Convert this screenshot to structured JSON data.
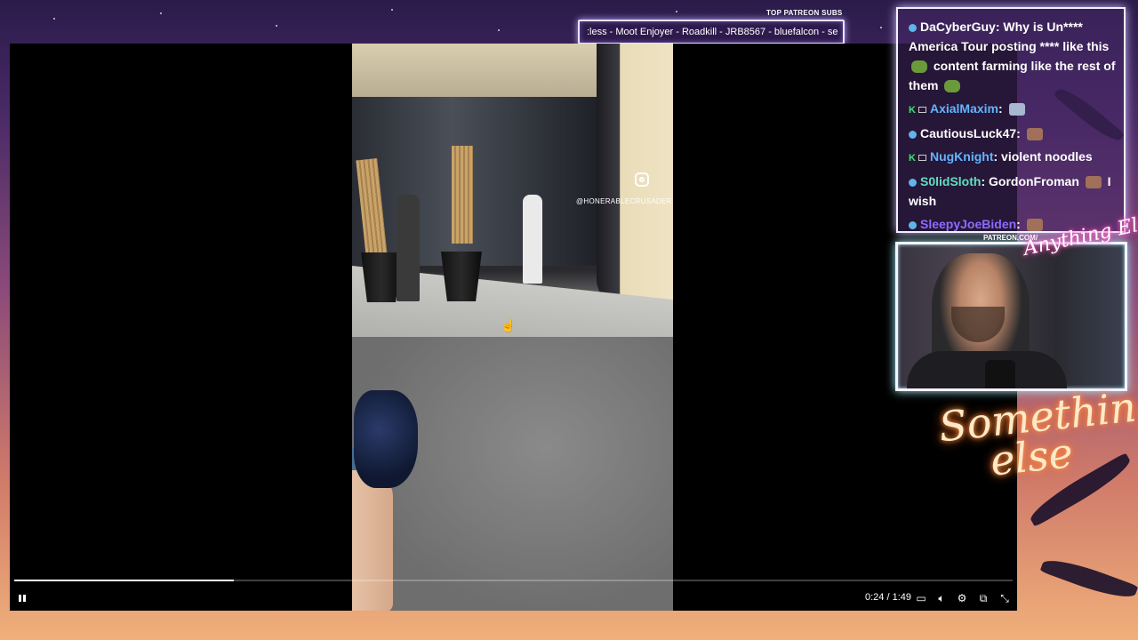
{
  "ticker": {
    "title": "TOP PATREON SUBS",
    "text": ":less - Moot Enjoyer - Roadkill - JRB8567 - bluefalcon - se"
  },
  "video": {
    "watermark_handle": "@HONERABLECRUSADER",
    "time": "0:24 / 1:49",
    "progress_fraction": 0.22
  },
  "chat": {
    "messages": [
      {
        "user": "DaCyberGuy",
        "user_color": "#ffffff",
        "text": " Why is Un**** America Tour posting **** like this",
        "suffix": " content farming like the rest of them"
      },
      {
        "user": "AxialMaxim",
        "user_color": "#62b4ff",
        "text": ":"
      },
      {
        "user": "CautiousLuck47",
        "user_color": "#ffffff",
        "text": ":"
      },
      {
        "user": "NugKnight",
        "user_color": "#62b4ff",
        "text": ": violent noodles"
      },
      {
        "user": "S0lidSloth",
        "user_color": "#5fe0c0",
        "text": ": GordonFroman",
        "suffix": " I wish"
      },
      {
        "user": "SleepyJoeBiden",
        "user_color": "#8b6cff",
        "text": ":"
      }
    ]
  },
  "overlay": {
    "patreon_url": "PATREON.COM/",
    "logo_small": "Anything Else",
    "logo_big_line1": "Something",
    "logo_big_line2": "else"
  }
}
